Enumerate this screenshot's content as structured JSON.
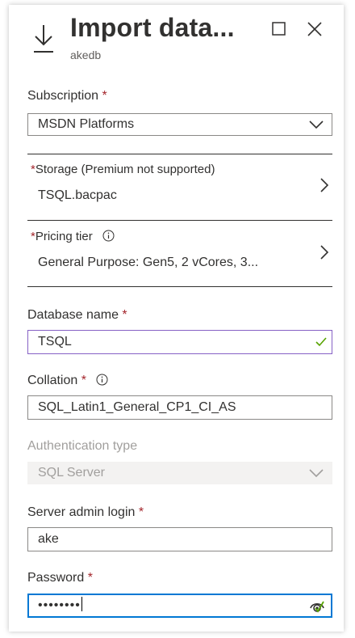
{
  "header": {
    "title": "Import data...",
    "subtitle": "akedb"
  },
  "subscription": {
    "label": "Subscription",
    "required_mark": "*",
    "value": "MSDN Platforms"
  },
  "storage": {
    "required_mark": "*",
    "label": "Storage (Premium not supported)",
    "value": "TSQL.bacpac"
  },
  "pricing": {
    "required_mark": "*",
    "label": "Pricing tier",
    "value": "General Purpose: Gen5, 2 vCores, 3..."
  },
  "database_name": {
    "label": "Database name",
    "required_mark": "*",
    "value": "TSQL"
  },
  "collation": {
    "label": "Collation",
    "required_mark": "*",
    "value": "SQL_Latin1_General_CP1_CI_AS"
  },
  "auth_type": {
    "label": "Authentication type",
    "value": "SQL Server"
  },
  "admin_login": {
    "label": "Server admin login",
    "required_mark": "*",
    "value": "ake"
  },
  "password": {
    "label": "Password",
    "required_mark": "*",
    "masked_value": "••••••••"
  },
  "colors": {
    "required": "#a4262c",
    "focus_blue": "#0078d4",
    "valid_border": "#8661c5",
    "valid_check": "#57a300",
    "disabled_text": "#a19f9d"
  },
  "icons": [
    "download-icon",
    "maximize-icon",
    "close-icon",
    "chevron-down-icon",
    "chevron-right-icon",
    "info-icon",
    "checkmark-icon",
    "password-reveal-icon"
  ]
}
